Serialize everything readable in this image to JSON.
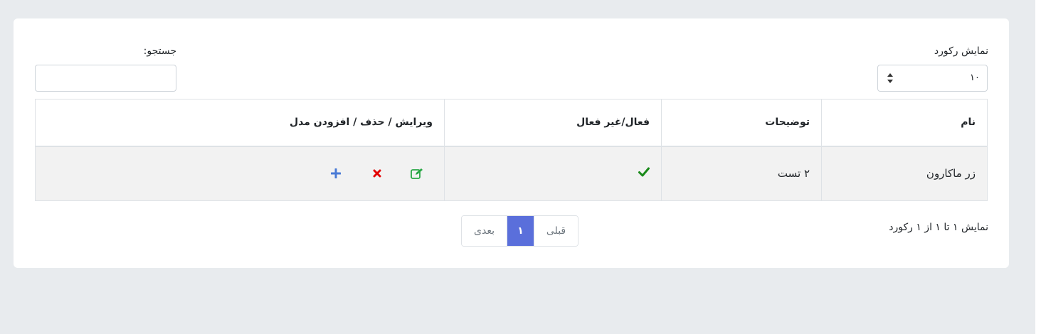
{
  "controls": {
    "show_records_label": "نمایش رکورد",
    "page_size_value": "۱۰",
    "search_label": "جستجو:",
    "search_value": ""
  },
  "table": {
    "columns": [
      "نام",
      "توضیحات",
      "فعال/غیر فعال",
      "ویرایش / حذف / افزودن مدل"
    ],
    "rows": [
      {
        "name": "زر ماکارون",
        "description": "۲ تست",
        "active": true
      }
    ]
  },
  "footer": {
    "info": "نمایش ۱ تا ۱ از ۱ رکورد",
    "prev_label": "قبلی",
    "current_page": "۱",
    "next_label": "بعدی"
  },
  "colors": {
    "page_background": "#e8ebee",
    "active_check": "#1a8a1a",
    "edit_icon": "#28a745",
    "delete_icon": "#e30000",
    "add_icon": "#4a7bd6",
    "pagination_active": "#5a6fdb"
  },
  "icons": {
    "active": "check-icon",
    "edit": "edit-icon",
    "delete": "delete-icon",
    "add": "plus-icon",
    "select_arrows": "sort-arrows-icon"
  }
}
